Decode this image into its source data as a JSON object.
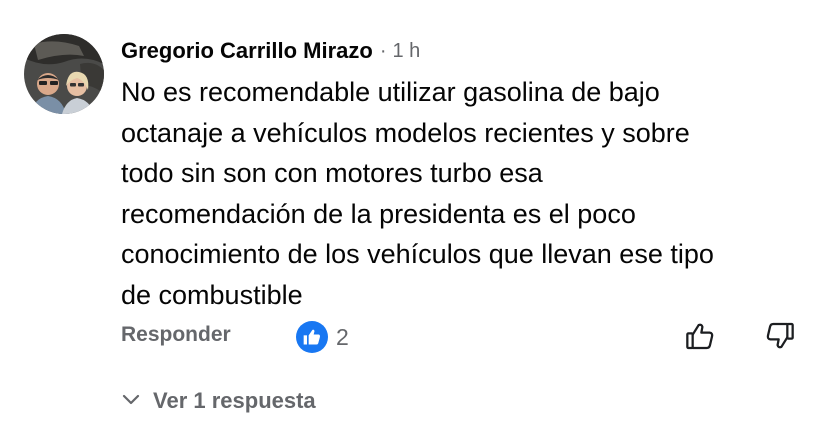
{
  "comment": {
    "author": "Gregorio Carrillo Mirazo",
    "separator": "·",
    "time": "1 h",
    "text": "No es recomendable utilizar gasolina de bajo\noctanaje a vehículos modelos recientes y sobre\ntodo sin son con motores turbo esa\nrecomendación de la presidenta es el poco\nconocimiento de los vehículos que llevan ese tipo\nde combustible",
    "avatar_icon": "profile-photo-two-people"
  },
  "actions": {
    "reply_label": "Responder",
    "reaction_icon": "like-reaction-icon",
    "reaction_count": "2",
    "upvote_icon": "thumbs-up-icon",
    "downvote_icon": "thumbs-down-icon"
  },
  "replies": {
    "toggle_icon": "chevron-down-icon",
    "label": "Ver 1 respuesta"
  },
  "colors": {
    "text_primary": "#050505",
    "text_secondary": "#65676b",
    "like_blue": "#1877f2"
  }
}
